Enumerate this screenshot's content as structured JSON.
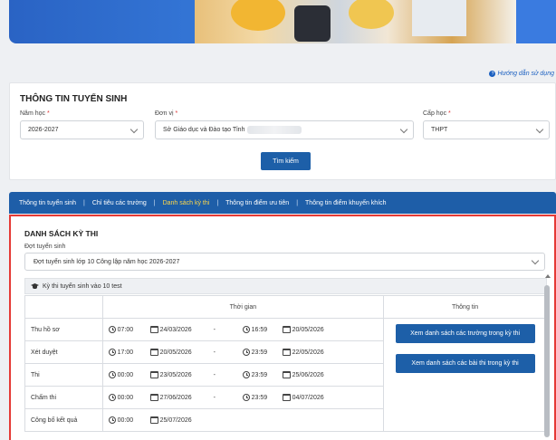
{
  "help_link": "Hướng dẫn sử dụng",
  "search": {
    "title": "THÔNG TIN TUYỂN SINH",
    "year_label": "Năm học",
    "year_value": "2026-2027",
    "unit_label": "Đơn vị",
    "unit_value": "Sở Giáo dục và Đào tạo Tỉnh",
    "level_label": "Cấp học",
    "level_value": "THPT",
    "required_mark": "*",
    "button": "Tìm kiếm"
  },
  "nav": {
    "items": [
      "Thông tin tuyển sinh",
      "Chỉ tiêu các trường",
      "Danh sách kỳ thi",
      "Thông tin điểm ưu tiên",
      "Thông tin điểm khuyến khích"
    ],
    "separator": "|",
    "active_index": 2
  },
  "exams": {
    "title": "DANH SÁCH KỲ THI",
    "round_label": "Đợt tuyển sinh",
    "round_value": "Đợt tuyển sinh lớp 10 Công lập năm học 2026-2027",
    "group_title": "Kỳ thi tuyển sinh vào 10 test",
    "col_time": "Thời gian",
    "col_info": "Thông tin",
    "dash": "-",
    "rows": [
      {
        "name": "Thu hồ sơ",
        "start_time": "07:00",
        "start_date": "24/03/2026",
        "end_time": "16:59",
        "end_date": "20/05/2026"
      },
      {
        "name": "Xét duyệt",
        "start_time": "17:00",
        "start_date": "20/05/2026",
        "end_time": "23:59",
        "end_date": "22/05/2026"
      },
      {
        "name": "Thi",
        "start_time": "00:00",
        "start_date": "23/05/2026",
        "end_time": "23:59",
        "end_date": "25/06/2026"
      },
      {
        "name": "Chấm thi",
        "start_time": "00:00",
        "start_date": "27/06/2026",
        "end_time": "23:59",
        "end_date": "04/07/2026"
      },
      {
        "name": "Công bố kết quả",
        "start_time": "00:00",
        "start_date": "25/07/2026",
        "end_time": "",
        "end_date": ""
      }
    ],
    "btn_schools": "Xem danh sách các trường trong kỳ thi",
    "btn_exams": "Xem danh sách các bài thi trong kỳ thi"
  }
}
